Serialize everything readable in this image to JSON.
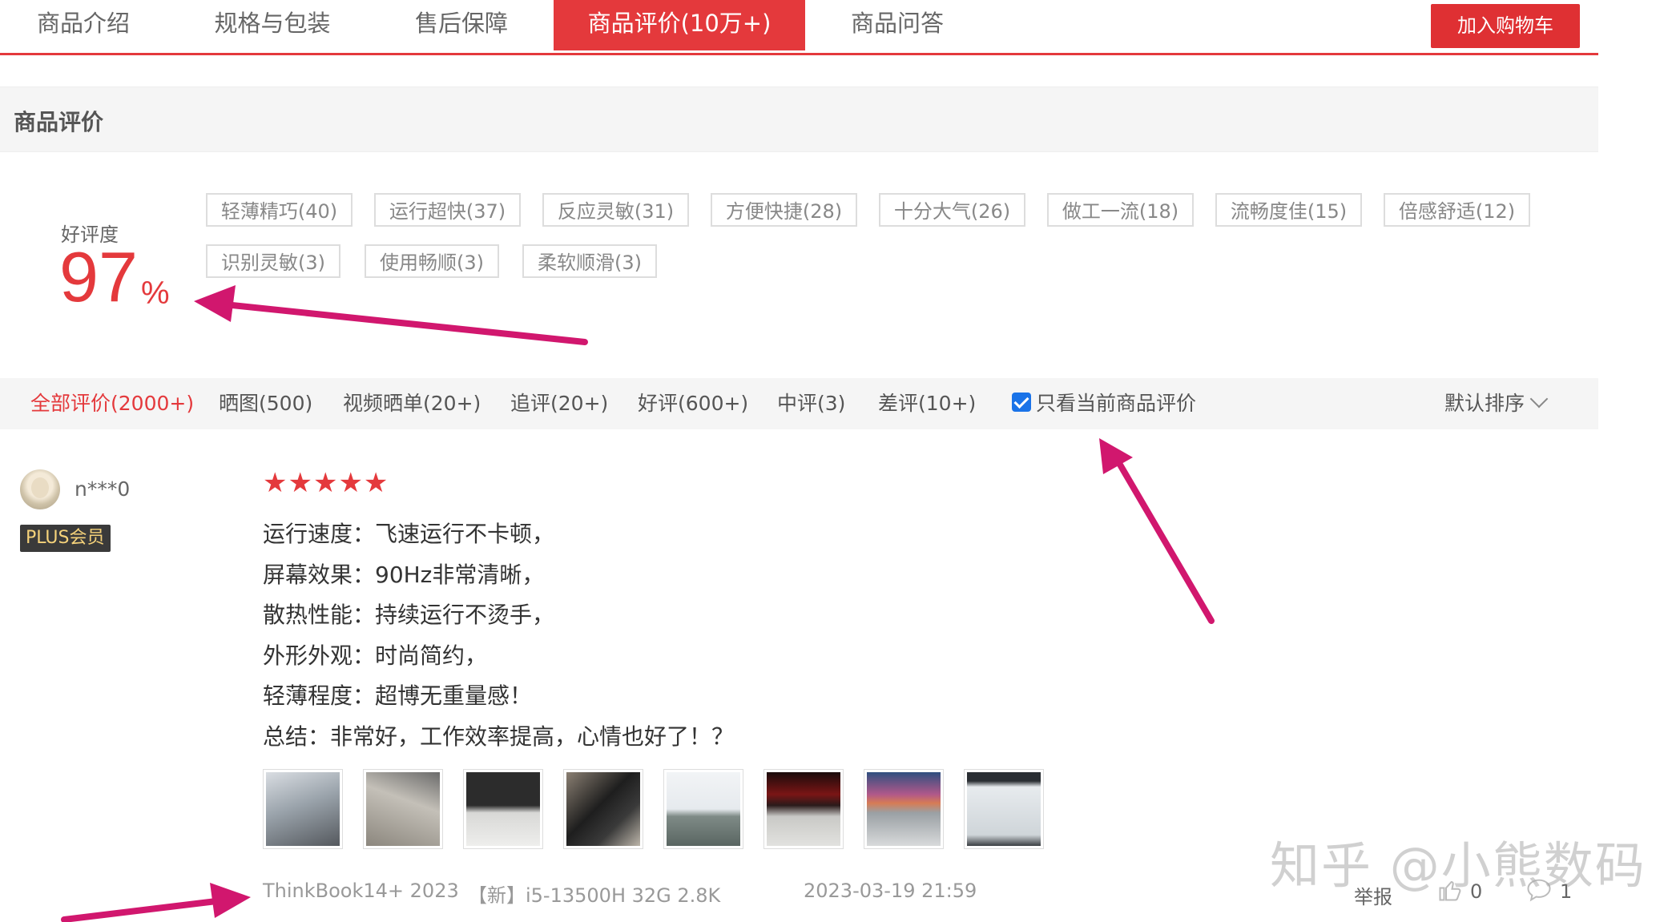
{
  "tabs": [
    {
      "label": "商品介绍"
    },
    {
      "label": "规格与包装"
    },
    {
      "label": "售后保障"
    },
    {
      "label": "商品评价(10万+)"
    },
    {
      "label": "商品问答"
    }
  ],
  "cart_button": "加入购物车",
  "section_title": "商品评价",
  "rating": {
    "label": "好评度",
    "value": "97",
    "unit": "%"
  },
  "tags": [
    "轻薄精巧(40)",
    "运行超快(37)",
    "反应灵敏(31)",
    "方便快捷(28)",
    "十分大气(26)",
    "做工一流(18)",
    "流畅度佳(15)",
    "倍感舒适(12)",
    "识别灵敏(3)",
    "使用畅顺(3)",
    "柔软顺滑(3)"
  ],
  "filters": [
    "全部评价(2000+)",
    "晒图(500)",
    "视频晒单(20+)",
    "追评(20+)",
    "好评(600+)",
    "中评(3)",
    "差评(10+)"
  ],
  "only_current": "只看当前商品评价",
  "sort_label": "默认排序",
  "review": {
    "username": "n***0",
    "badge": "PLUS会员",
    "stars": "★★★★★",
    "lines": [
      "运行速度：飞速运行不卡顿，",
      "屏幕效果：90Hz非常清晰，",
      "散热性能：持续运行不烫手，",
      "外形外观：时尚简约，",
      "轻薄程度：超博无重量感！",
      "总结：非常好，工作效率提高，心情也好了！？"
    ],
    "model": "ThinkBook14+ 2023",
    "spec": "【新】i5-13500H 32G 2.8K",
    "date": "2023-03-19 21:59",
    "report": "举报",
    "likes": "0",
    "comments": "1"
  },
  "watermark": "知乎 @小熊数码",
  "colors": {
    "accent": "#e4393c",
    "annotation": "#d1176e"
  }
}
